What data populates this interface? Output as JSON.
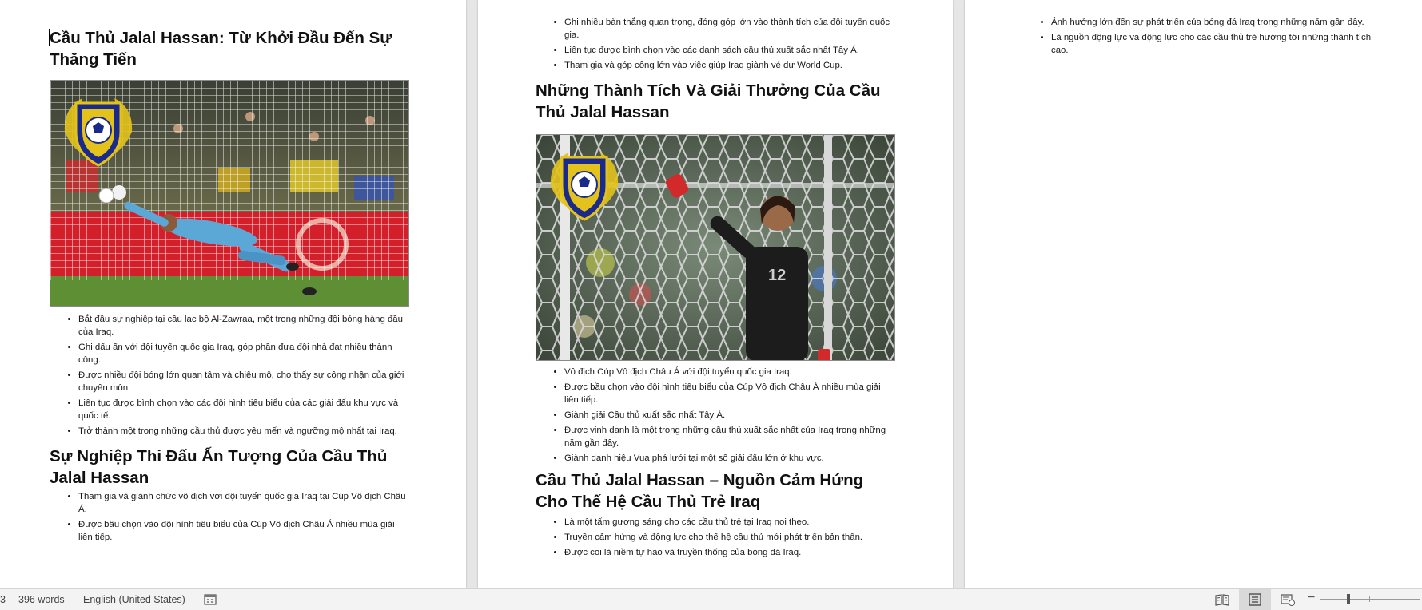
{
  "page1": {
    "heading1": "Cầu Thủ Jalal Hassan: Từ Khởi Đầu Đến Sự Thăng Tiến",
    "bullets1": [
      "Bắt đầu sự nghiệp tại câu lạc bộ Al-Zawraa, một trong những đội bóng hàng đầu của Iraq.",
      "Ghi dấu ấn với đội tuyển quốc gia Iraq, góp phần đưa đội nhà đạt nhiều thành công.",
      "Được nhiều đội bóng lớn quan tâm và chiêu mộ, cho thấy sự công nhận của giới chuyên môn.",
      "Liên tục được bình chọn vào các đội hình tiêu biểu của các giải đấu khu vực và quốc tế.",
      "Trở thành một trong những cầu thủ được yêu mến và ngưỡng mộ nhất tại Iraq."
    ],
    "heading2": "Sự Nghiệp Thi Đấu Ấn Tượng Của Cầu Thủ Jalal Hassan",
    "bullets2": [
      "Tham gia và giành chức vô địch với đội tuyển quốc gia Iraq tại Cúp Vô địch Châu Á.",
      "Được bầu chọn vào đội hình tiêu biểu của Cúp Vô địch Châu Á nhiều mùa giải liên tiếp."
    ]
  },
  "page2": {
    "bullets_top": [
      "Ghi nhiều bàn thắng quan trọng, đóng góp lớn vào thành tích của đội tuyển quốc gia.",
      "Liên tục được bình chọn vào các danh sách cầu thủ xuất sắc nhất Tây Á.",
      "Tham gia và góp công lớn vào việc giúp Iraq giành vé dự World Cup."
    ],
    "heading1": "Những Thành Tích Và Giải Thưởng Của Cầu Thủ Jalal Hassan",
    "bullets1": [
      "Vô địch Cúp Vô địch Châu Á với đội tuyển quốc gia Iraq.",
      "Được bầu chọn vào đội hình tiêu biểu của Cúp Vô địch Châu Á nhiều mùa giải liên tiếp.",
      "Giành giải Cầu thủ xuất sắc nhất Tây Á.",
      "Được vinh danh là một trong những cầu thủ xuất sắc nhất của Iraq trong những năm gần đây.",
      "Giành danh hiệu Vua phá lưới tại một số giải đấu lớn ở khu vực."
    ],
    "heading2": "Cầu Thủ Jalal Hassan – Nguồn Cảm Hứng Cho Thế Hệ Cầu Thủ Trẻ Iraq",
    "bullets2": [
      "Là một tấm gương sáng cho các cầu thủ trẻ tại Iraq noi theo.",
      "Truyền cảm hứng và động lực cho thế hệ cầu thủ mới phát triển bản thân.",
      "Được coi là niềm tự hào và truyền thống của bóng đá Iraq."
    ],
    "jersey_number": "12"
  },
  "page3": {
    "bullets": [
      "Ảnh hưởng lớn đến sự phát triển của bóng đá Iraq trong những năm gần đây.",
      "Là nguồn động lực và động lực cho các cầu thủ trẻ hướng tới những thành tích cao."
    ]
  },
  "status_bar": {
    "page_fragment": "3",
    "word_count": "396 words",
    "language": "English (United States)",
    "icons": [
      "proofing-icon",
      "read-mode-icon",
      "print-layout-icon",
      "web-layout-icon",
      "zoom-out-icon",
      "zoom-slider"
    ]
  },
  "colors": {
    "crest_blue": "#1a2a8c",
    "crest_gold": "#e3c21b",
    "grass": "#5e8f35",
    "keeper_blue": "#5ba7d6"
  }
}
